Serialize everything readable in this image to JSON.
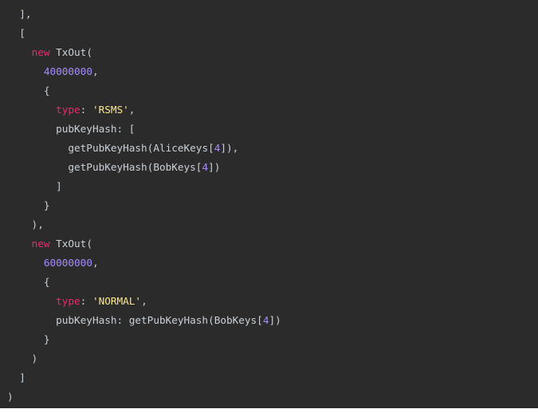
{
  "code": {
    "language": "javascript",
    "lines": [
      {
        "tokens": [
          {
            "t": "punct",
            "v": "  ],"
          }
        ]
      },
      {
        "tokens": [
          {
            "t": "punct",
            "v": "  ["
          }
        ]
      },
      {
        "tokens": [
          {
            "t": "punct",
            "v": "    "
          },
          {
            "t": "kw",
            "v": "new"
          },
          {
            "t": "ident",
            "v": " TxOut("
          }
        ]
      },
      {
        "tokens": [
          {
            "t": "punct",
            "v": "      "
          },
          {
            "t": "num",
            "v": "40000000"
          },
          {
            "t": "punct",
            "v": ","
          }
        ]
      },
      {
        "tokens": [
          {
            "t": "punct",
            "v": "      {"
          }
        ]
      },
      {
        "tokens": [
          {
            "t": "punct",
            "v": "        "
          },
          {
            "t": "prop",
            "v": "type"
          },
          {
            "t": "punct",
            "v": ": "
          },
          {
            "t": "str",
            "v": "'RSMS'"
          },
          {
            "t": "punct",
            "v": ","
          }
        ]
      },
      {
        "tokens": [
          {
            "t": "punct",
            "v": "        "
          },
          {
            "t": "ident",
            "v": "pubKeyHash: ["
          }
        ]
      },
      {
        "tokens": [
          {
            "t": "punct",
            "v": "          "
          },
          {
            "t": "ident",
            "v": "getPubKeyHash(AliceKeys["
          },
          {
            "t": "num",
            "v": "4"
          },
          {
            "t": "ident",
            "v": "]),"
          }
        ]
      },
      {
        "tokens": [
          {
            "t": "punct",
            "v": "          "
          },
          {
            "t": "ident",
            "v": "getPubKeyHash(BobKeys["
          },
          {
            "t": "num",
            "v": "4"
          },
          {
            "t": "ident",
            "v": "])"
          }
        ]
      },
      {
        "tokens": [
          {
            "t": "punct",
            "v": "        ]"
          }
        ]
      },
      {
        "tokens": [
          {
            "t": "punct",
            "v": "      }"
          }
        ]
      },
      {
        "tokens": [
          {
            "t": "punct",
            "v": "    ),"
          }
        ]
      },
      {
        "tokens": [
          {
            "t": "punct",
            "v": "    "
          },
          {
            "t": "kw",
            "v": "new"
          },
          {
            "t": "ident",
            "v": " TxOut("
          }
        ]
      },
      {
        "tokens": [
          {
            "t": "punct",
            "v": "      "
          },
          {
            "t": "num",
            "v": "60000000"
          },
          {
            "t": "punct",
            "v": ","
          }
        ]
      },
      {
        "tokens": [
          {
            "t": "punct",
            "v": "      {"
          }
        ]
      },
      {
        "tokens": [
          {
            "t": "punct",
            "v": "        "
          },
          {
            "t": "prop",
            "v": "type"
          },
          {
            "t": "punct",
            "v": ": "
          },
          {
            "t": "str",
            "v": "'NORMAL'"
          },
          {
            "t": "punct",
            "v": ","
          }
        ]
      },
      {
        "tokens": [
          {
            "t": "punct",
            "v": "        "
          },
          {
            "t": "ident",
            "v": "pubKeyHash: getPubKeyHash(BobKeys["
          },
          {
            "t": "num",
            "v": "4"
          },
          {
            "t": "ident",
            "v": "])"
          }
        ]
      },
      {
        "tokens": [
          {
            "t": "punct",
            "v": "      }"
          }
        ]
      },
      {
        "tokens": [
          {
            "t": "punct",
            "v": "    )"
          }
        ]
      },
      {
        "tokens": [
          {
            "t": "punct",
            "v": "  ]"
          }
        ]
      },
      {
        "tokens": [
          {
            "t": "punct",
            "v": ")"
          }
        ]
      }
    ]
  },
  "colors": {
    "background": "#2b2b2b",
    "keyword": "#f0266f",
    "number": "#a78bfa",
    "string": "#fde68a",
    "text": "#c9d1d9"
  }
}
